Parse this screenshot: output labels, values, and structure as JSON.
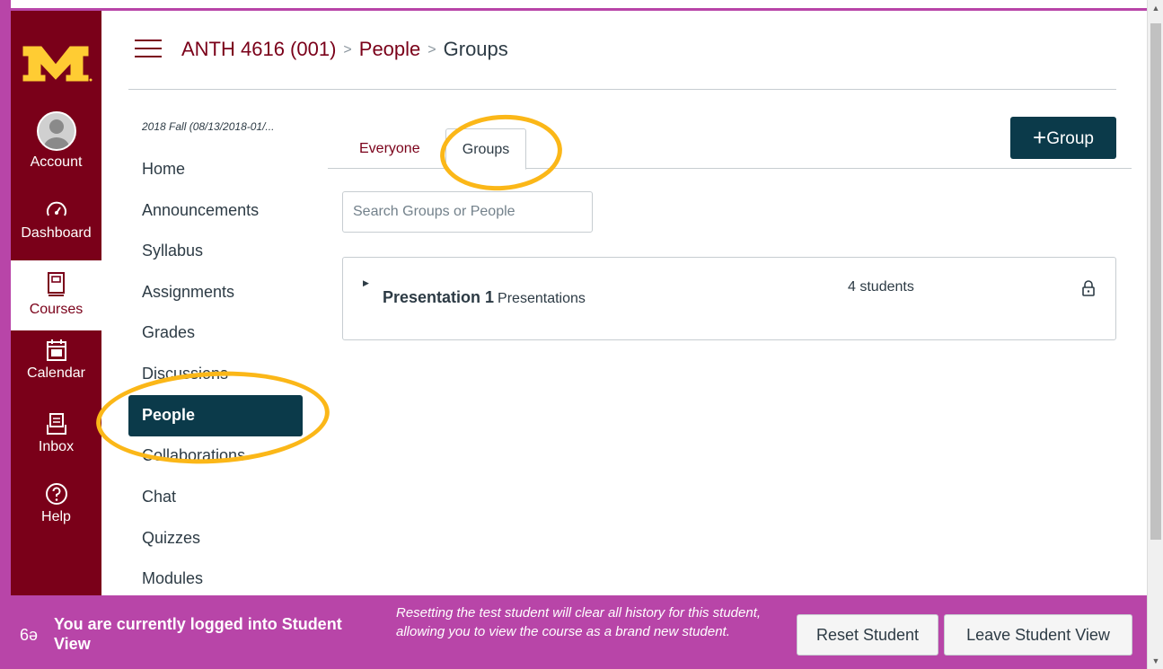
{
  "global_nav": {
    "items": [
      {
        "label": "Account",
        "icon": "account-avatar"
      },
      {
        "label": "Dashboard",
        "icon": "dashboard-icon"
      },
      {
        "label": "Courses",
        "icon": "courses-icon"
      },
      {
        "label": "Calendar",
        "icon": "calendar-icon"
      },
      {
        "label": "Inbox",
        "icon": "inbox-icon"
      },
      {
        "label": "Help",
        "icon": "help-icon"
      }
    ],
    "active": "Courses",
    "brand_color": "#7a0019",
    "logo_accent": "#ffcc33"
  },
  "breadcrumb": {
    "course": "ANTH 4616 (001)",
    "section": "People",
    "current": "Groups"
  },
  "course_nav": {
    "term": "2018 Fall (08/13/2018-01/...",
    "items": [
      "Home",
      "Announcements",
      "Syllabus",
      "Assignments",
      "Grades",
      "Discussions",
      "People",
      "Collaborations",
      "Chat",
      "Quizzes",
      "Modules"
    ],
    "active": "People"
  },
  "tabs": {
    "everyone": "Everyone",
    "groups": "Groups",
    "active": "Groups"
  },
  "add_group_button": {
    "icon": "plus-icon",
    "label": "Group"
  },
  "search": {
    "placeholder": "Search Groups or People",
    "value": ""
  },
  "groups": [
    {
      "name": "Presentation 1",
      "category": "Presentations",
      "count": "4 students",
      "locked": true
    }
  ],
  "student_view": {
    "message": "You are currently logged into Student View",
    "warning": "Resetting the test student will clear all history for this student, allowing you to view the course as a brand new student.",
    "reset_button": "Reset Student",
    "leave_button": "Leave Student View",
    "bar_color": "#b845a8"
  },
  "annotation_color": "#fbb718"
}
